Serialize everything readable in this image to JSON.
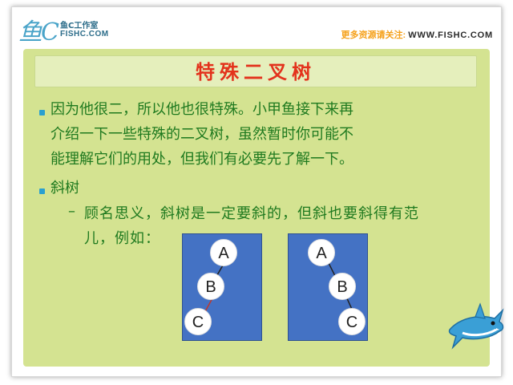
{
  "header": {
    "logo_script": "鱼C",
    "logo_cn": "鱼C工作室",
    "logo_en": "FISHC.COM",
    "follow_label": "更多资源请关注:",
    "follow_url": "WWW.FISHC.COM"
  },
  "slide": {
    "title": "特殊二叉树",
    "bullets": [
      {
        "lines": [
          "因为他很二，所以他也很特殊。小甲鱼接下来再",
          "介绍一下一些特殊的二叉树，虽然暂时你可能不",
          "能理解它们的用处，但我们有必要先了解一下。"
        ]
      },
      {
        "text": "斜树",
        "sub_dash": "–",
        "sub_lines": [
          "顾名思义，斜树是一定要斜的，但斜也要斜得有范",
          "儿，例如："
        ]
      }
    ]
  },
  "trees": [
    {
      "nodes": [
        "A",
        "B",
        "C"
      ],
      "direction": "left"
    },
    {
      "nodes": [
        "A",
        "B",
        "C"
      ],
      "direction": "right"
    }
  ],
  "colors": {
    "accent_title": "#e3321c",
    "content_bg": "#d4e391",
    "text": "#1f7a1f",
    "bullet": "#2aa0d0",
    "panel": "#4472c4"
  }
}
